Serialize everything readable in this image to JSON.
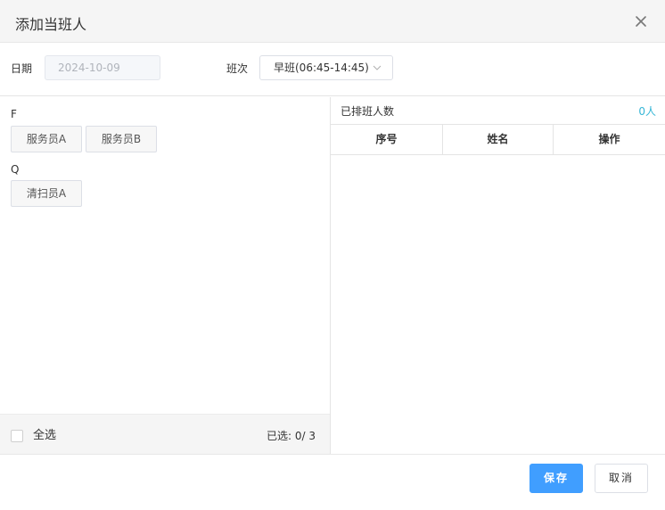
{
  "dialog": {
    "title": "添加当班人"
  },
  "form": {
    "date_label": "日期",
    "date_value": "2024-10-09",
    "shift_label": "班次",
    "shift_value": "早班(06:45-14:45)"
  },
  "staff_groups": [
    {
      "letter": "F",
      "members": [
        "服务员A",
        "服务员B"
      ]
    },
    {
      "letter": "Q",
      "members": [
        "清扫员A"
      ]
    }
  ],
  "left_footer": {
    "select_all_label": "全选",
    "selected_text": "已选: 0/ 3"
  },
  "right_panel": {
    "title": "已排班人数",
    "count": "0人",
    "columns": [
      "序号",
      "姓名",
      "操作"
    ]
  },
  "actions": {
    "save_label": "保存",
    "cancel_label": "取消"
  },
  "colors": {
    "primary": "#409eff",
    "count_accent": "#36b6d6"
  }
}
